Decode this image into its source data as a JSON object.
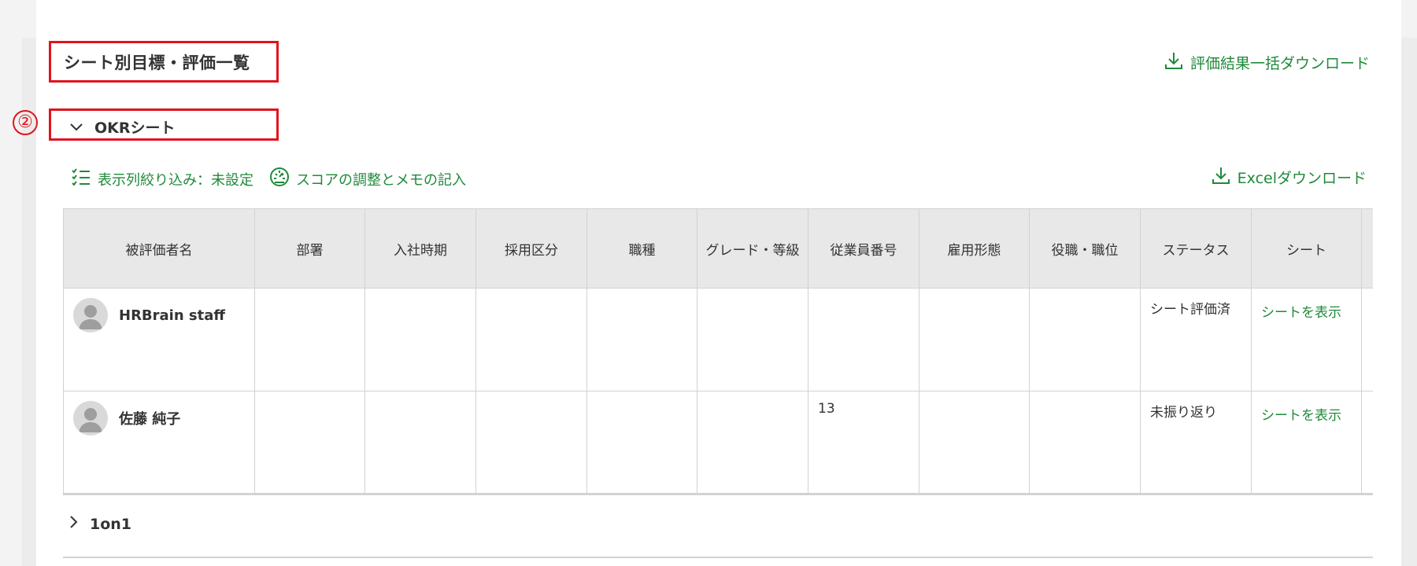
{
  "page": {
    "title": "シート別目標・評価一覧",
    "bulk_download": "評価結果一括ダウンロード"
  },
  "annotation": {
    "marker": "②"
  },
  "section": {
    "label": "OKRシート",
    "filter_label": "表示列絞り込み：未設定",
    "score_label": "スコアの調整とメモの記入",
    "excel_download": "Excelダウンロード"
  },
  "table": {
    "headers": [
      "被評価者名",
      "部署",
      "入社時期",
      "採用区分",
      "職種",
      "グレード・等級",
      "従業員番号",
      "雇用形態",
      "役職・職位",
      "ステータス",
      "シート",
      ""
    ],
    "rows": [
      {
        "name": "HRBrain staff",
        "employee_no": "",
        "status": "シート評価済",
        "sheet_link": "シートを表示"
      },
      {
        "name": "佐藤 純子",
        "employee_no": "13",
        "status": "未振り返り",
        "sheet_link": "シートを表示"
      }
    ]
  },
  "collapsed_section": {
    "label": "1on1"
  },
  "colors": {
    "accent": "#1f8a3a",
    "annotation": "#e0141e"
  }
}
